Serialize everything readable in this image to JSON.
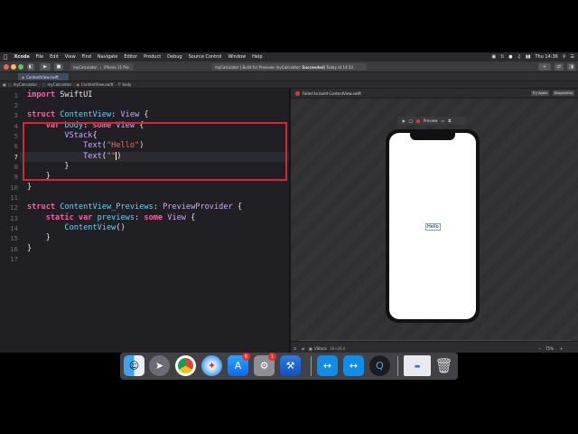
{
  "menubar": {
    "app": "Xcode",
    "items": [
      "File",
      "Edit",
      "View",
      "Find",
      "Navigate",
      "Editor",
      "Product",
      "Debug",
      "Source Control",
      "Window",
      "Help"
    ],
    "clock": "Thu 14:36"
  },
  "toolbar": {
    "scheme_project": "myCalculator",
    "scheme_device": "iPhone 11 Pro",
    "activity_prefix": "myCalculator | Build for Previews myCalculator: ",
    "activity_status": "Succeeded",
    "activity_time": " | Today at 14:33"
  },
  "tab": {
    "label": "ContentView.swift"
  },
  "jumpbar": {
    "items": [
      "myCalculator",
      "myCalculator",
      "ContentView.swift",
      "body"
    ]
  },
  "editor": {
    "line_numbers": [
      "1",
      "2",
      "3",
      "4",
      "5",
      "6",
      "7",
      "8",
      "9",
      "10",
      "11",
      "12",
      "13",
      "14",
      "15",
      "16",
      "17"
    ],
    "current_line": "7",
    "lines": [
      {
        "kw1": "import",
        "rest": " SwiftUI"
      },
      {},
      {
        "kw1": "struct",
        "name": " ContentView",
        "colon": ": ",
        "ty": "View",
        "tail": " {"
      },
      {
        "indent": "    ",
        "kw1": "var",
        "ident": " body",
        "colon": ": ",
        "kw2": "some",
        "ty": " View",
        "tail": " {"
      },
      {
        "indent": "        ",
        "ty": "VStack",
        "tail": "{"
      },
      {
        "indent": "            ",
        "ty": "Text",
        "open": "(",
        "str": "\"Hello\"",
        "tail": ")"
      },
      {
        "indent": "            ",
        "ty": "Text",
        "open": "(",
        "str": "\"\"",
        "tail": ")"
      },
      {
        "indent": "        ",
        "tail": "}"
      },
      {
        "indent": "    ",
        "tail": "}"
      },
      {
        "tail": "}"
      },
      {},
      {
        "kw1": "struct",
        "name": " ContentView_Previews",
        "colon": ": ",
        "ty": "PreviewProvider",
        "tail": " {"
      },
      {
        "indent": "    ",
        "kw1": "static",
        "kw2": " var",
        "ident": " previews",
        "colon": ": ",
        "kw3": "some",
        "ty": " View",
        "tail": " {"
      },
      {
        "indent": "        ",
        "ty": "ContentView",
        "tail": "()"
      },
      {
        "indent": "    ",
        "tail": "}"
      },
      {
        "tail": "}"
      },
      {}
    ]
  },
  "canvas": {
    "error_text": "Failed to build ContentView.swift",
    "try_again": "Try Again",
    "diagnostics": "Diagnostics",
    "preview_label": "Preview",
    "hello_text": "Hello",
    "footer_selection": "VStack",
    "footer_size": "36×26.0",
    "zoom": "75%"
  },
  "dock": {
    "apps": [
      "finder-icon",
      "launchpad-icon",
      "chrome-icon",
      "safari-icon",
      "app-store-icon",
      "system-preferences-icon",
      "xcode-icon",
      "teamviewer-icon",
      "teamviewer-icon-2",
      "quicktime-icon",
      "preview-doc-icon",
      "trash-icon"
    ],
    "app_store_badge": "6",
    "sysprefs_badge": "1"
  }
}
